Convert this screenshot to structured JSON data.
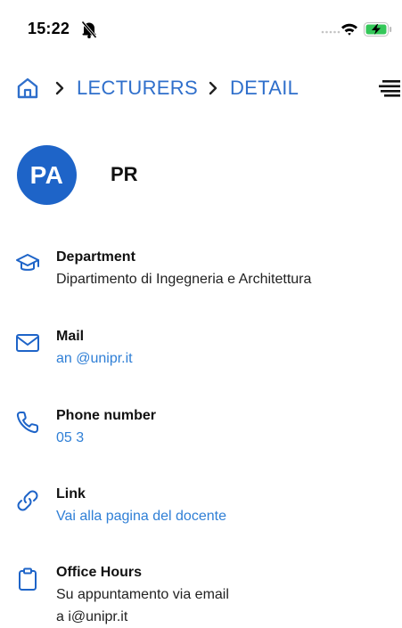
{
  "status_bar": {
    "time": "15:22",
    "bell_icon": "bell-slash-icon",
    "signal_icon": "cellular-signal-icon",
    "wifi_icon": "wifi-icon",
    "battery_icon": "battery-charging-icon",
    "battery_color": "#34c759"
  },
  "breadcrumb": {
    "home_icon": "home-icon",
    "items": [
      "LECTURERS",
      "DETAIL"
    ],
    "separator_icon": "chevron-right-icon"
  },
  "menu_icon": "hamburger-menu-icon",
  "profile": {
    "initials": "PA",
    "name": "PR",
    "avatar_color": "#1e64c8"
  },
  "details": {
    "department": {
      "icon": "graduation-cap-icon",
      "title": "Department",
      "value": "Dipartimento di Ingegneria e Architettura"
    },
    "mail": {
      "icon": "mail-icon",
      "title": "Mail",
      "value": "an                    @unipr.it"
    },
    "phone": {
      "icon": "phone-icon",
      "title": "Phone number",
      "value": "05                    3"
    },
    "link": {
      "icon": "link-icon",
      "title": "Link",
      "value": "Vai alla pagina del docente"
    },
    "office_hours": {
      "icon": "clipboard-icon",
      "title": "Office Hours",
      "value": "Su appuntamento via email",
      "value2": "a                    i@unipr.it"
    }
  },
  "colors": {
    "accent": "#2f6fcb",
    "link": "#2f7fd6",
    "text": "#111111"
  }
}
